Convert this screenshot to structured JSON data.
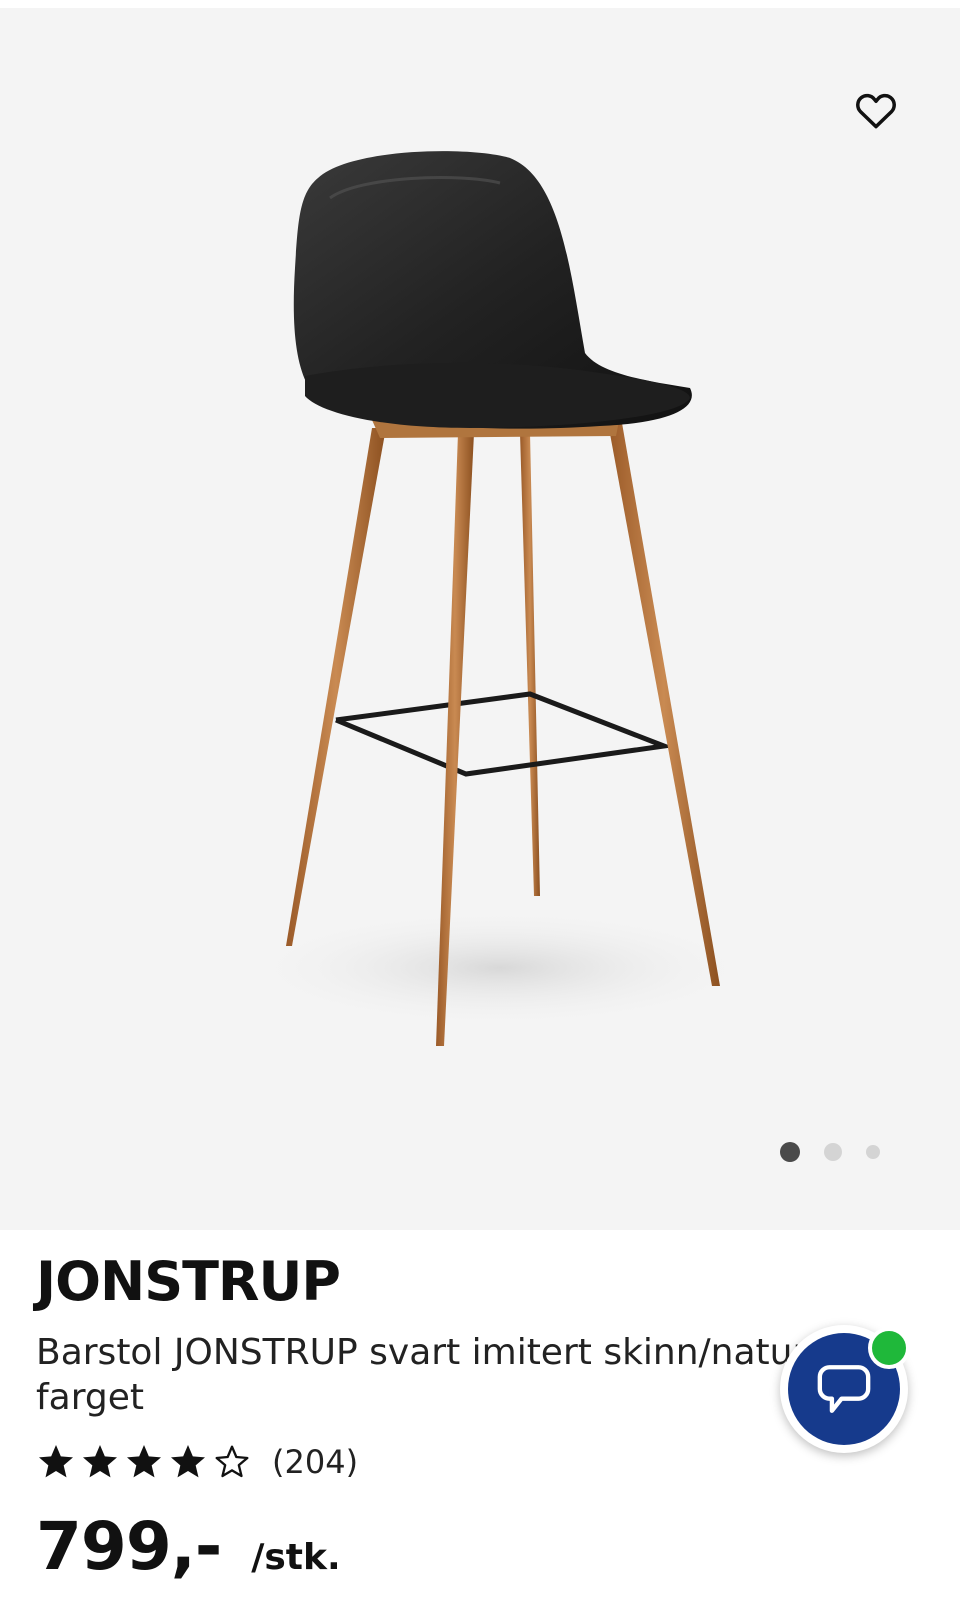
{
  "product": {
    "brand": "JONSTRUP",
    "description": "Barstol JONSTRUP svart imitert skinn/natur eike-farget",
    "rating_value": 4,
    "rating_max": 5,
    "review_count": "(204)",
    "price": "799,-",
    "unit": "/stk."
  },
  "gallery": {
    "image_count": 3,
    "active_index": 0
  },
  "icons": {
    "favorite": "heart-outline-icon",
    "chat": "chat-bubble-icon",
    "star_filled": "star-filled-icon",
    "star_empty": "star-outline-icon"
  },
  "colors": {
    "chat_button": "#163a8c",
    "online_badge": "#1fb83a",
    "gallery_background": "#f4f4f4",
    "dot_active": "#4a4a4a",
    "dot_inactive": "#d4d4d4"
  }
}
